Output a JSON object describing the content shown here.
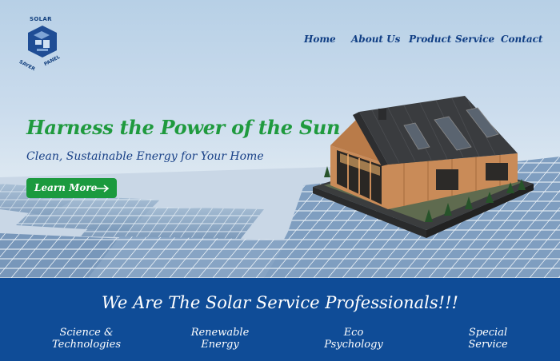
{
  "logo": {
    "top_text": "SOLAR",
    "left_text": "SAYER",
    "right_text": "PANEL"
  },
  "nav": {
    "items": [
      "Home",
      "About Us",
      "Product",
      "Service",
      "Contact"
    ]
  },
  "hero": {
    "headline": "Harness the Power of the Sun",
    "subheadline": "Clean, Sustainable Energy for Your Home",
    "cta_label": "Learn More"
  },
  "band": {
    "title": "We Are The Solar Service Professionals!!!",
    "services": [
      {
        "line1": "Science &",
        "line2": "Technologies"
      },
      {
        "line1": "Renewable",
        "line2": "Energy"
      },
      {
        "line1": "Eco",
        "line2": "Psychology"
      },
      {
        "line1": "Special",
        "line2": "Service"
      }
    ]
  },
  "colors": {
    "brand_blue": "#0f4c97",
    "accent_green": "#1b9a3e",
    "nav_text": "#103e84"
  }
}
